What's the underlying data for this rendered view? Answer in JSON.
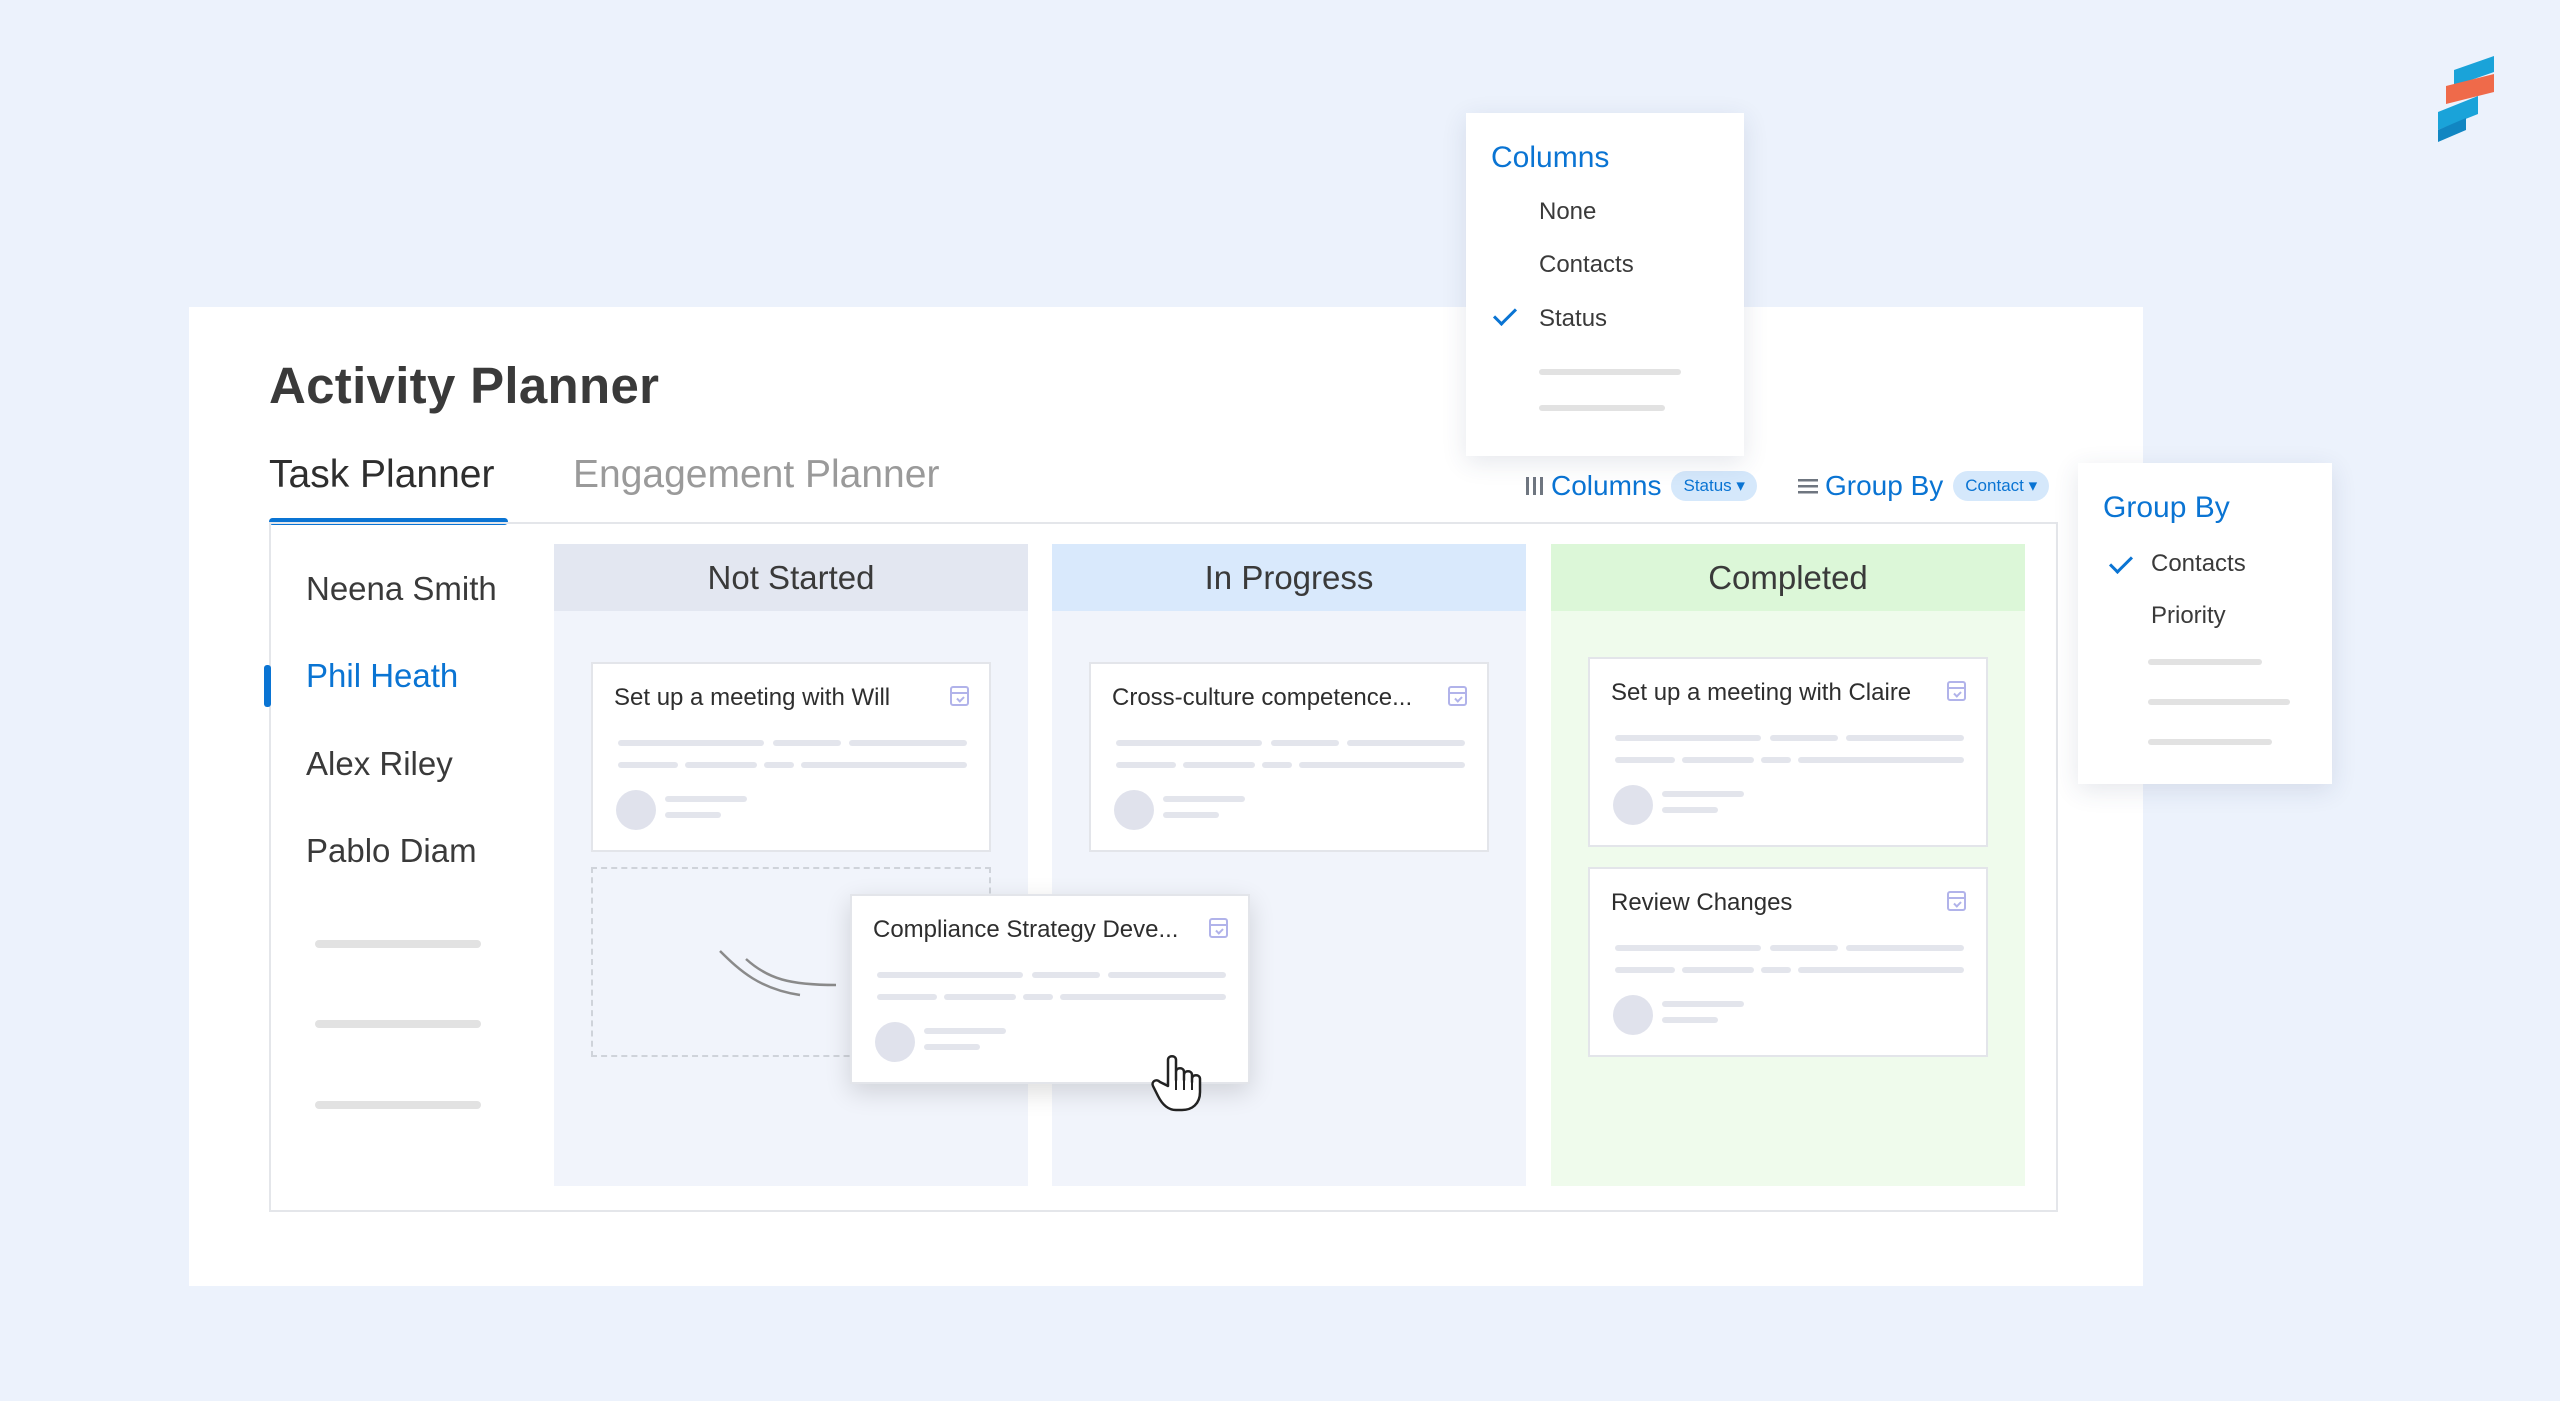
{
  "app": {
    "title": "Activity Planner"
  },
  "tabs": [
    {
      "label": "Task Planner",
      "active": true
    },
    {
      "label": "Engagement Planner",
      "active": false
    }
  ],
  "toolbar": {
    "columns": {
      "icon": "columns-icon",
      "label": "Columns",
      "badge": "Status ▾"
    },
    "group_by": {
      "icon": "list-icon",
      "label": "Group By",
      "badge": "Contact ▾"
    }
  },
  "contacts": [
    {
      "name": "Neena Smith",
      "active": false
    },
    {
      "name": "Phil Heath",
      "active": true
    },
    {
      "name": "Alex Riley",
      "active": false
    },
    {
      "name": "Pablo Diam",
      "active": false
    }
  ],
  "columns": [
    {
      "title": "Not Started",
      "cards": [
        {
          "title": "Set up a meeting with Will"
        }
      ]
    },
    {
      "title": "In Progress",
      "cards": [
        {
          "title": "Cross-culture competence..."
        }
      ]
    },
    {
      "title": "Completed",
      "cards": [
        {
          "title": "Set up a meeting with Claire"
        },
        {
          "title": "Review Changes"
        }
      ]
    }
  ],
  "dragging_card": {
    "title": "Compliance Strategy Deve..."
  },
  "columns_dropdown": {
    "title": "Columns",
    "options": [
      "None",
      "Contacts",
      "Status"
    ],
    "selected": "Status"
  },
  "group_by_dropdown": {
    "title": "Group By",
    "options": [
      "Contacts",
      "Priority"
    ],
    "selected": "Contacts"
  },
  "colors": {
    "accent": "#0a74d3",
    "not_started_header": "#e3e7f1",
    "in_progress_header": "#d9e9fc",
    "completed_header": "#dcf7d8",
    "background": "#ecf2fc"
  }
}
